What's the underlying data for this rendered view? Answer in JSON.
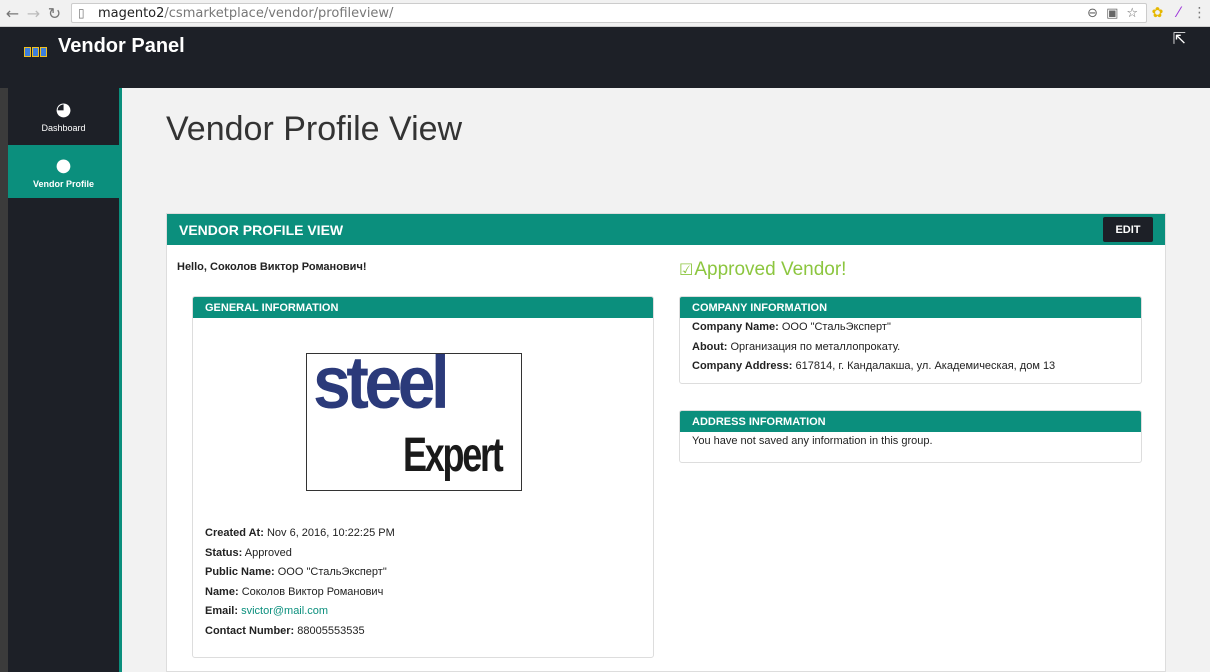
{
  "browser": {
    "url_host": "magento2",
    "url_path": "/csmarketplace/vendor/profileview/"
  },
  "header": {
    "brand": "Vendor Panel"
  },
  "sidebar": {
    "items": [
      {
        "label": "Dashboard",
        "icon": "dashboard-icon"
      },
      {
        "label": "Vendor Profile",
        "icon": "user-icon"
      }
    ]
  },
  "main": {
    "page_title": "Vendor Profile View",
    "panel_title": "VENDOR PROFILE VIEW",
    "edit_label": "EDIT",
    "greeting": "Hello, Соколов Виктор Романович!",
    "approved_text": "Approved Vendor!",
    "general": {
      "title": "GENERAL INFORMATION",
      "logo_line1": "steel",
      "logo_line2": "Expert",
      "created_at_label": "Created At:",
      "created_at": "Nov 6, 2016, 10:22:25 PM",
      "status_label": "Status:",
      "status": "Approved",
      "public_name_label": "Public Name:",
      "public_name": "ООО \"СтальЭксперт\"",
      "name_label": "Name:",
      "name": "Соколов Виктор Романович",
      "email_label": "Email:",
      "email": "svictor@mail.com",
      "contact_label": "Contact Number:",
      "contact": "88005553535"
    },
    "company": {
      "title": "COMPANY INFORMATION",
      "company_name_label": "Company Name:",
      "company_name": "ООО \"СтальЭксперт\"",
      "about_label": "About:",
      "about": "Организация по металлопрокату.",
      "address_label": "Company Address:",
      "address": "617814, г. Кандалакша, ул. Академическая, дом 13"
    },
    "address": {
      "title": "ADDRESS INFORMATION",
      "empty_text": "You have not saved any information in this group."
    }
  },
  "colors": {
    "accent": "#0b8f7d",
    "dark": "#1d2027",
    "approved": "#8cc63f"
  }
}
